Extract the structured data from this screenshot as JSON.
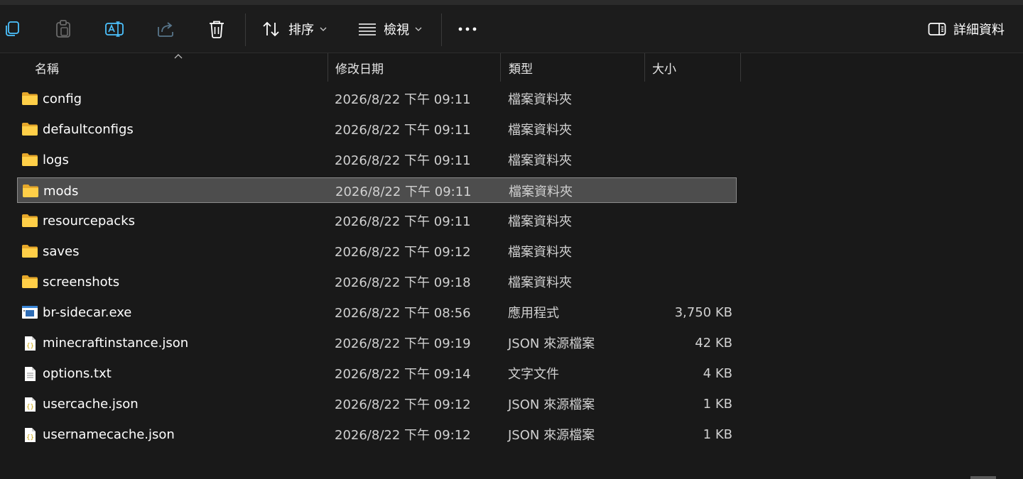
{
  "toolbar": {
    "sort_label": "排序",
    "view_label": "檢視",
    "details_label": "詳細資料"
  },
  "columns": {
    "name": "名稱",
    "modified": "修改日期",
    "type": "類型",
    "size": "大小"
  },
  "selected_index": 3,
  "files": [
    {
      "name": "config",
      "date": "2026/8/22 下午 09:11",
      "type": "檔案資料夾",
      "size": "",
      "icon": "folder-icon"
    },
    {
      "name": "defaultconfigs",
      "date": "2026/8/22 下午 09:11",
      "type": "檔案資料夾",
      "size": "",
      "icon": "folder-icon"
    },
    {
      "name": "logs",
      "date": "2026/8/22 下午 09:11",
      "type": "檔案資料夾",
      "size": "",
      "icon": "folder-icon"
    },
    {
      "name": "mods",
      "date": "2026/8/22 下午 09:11",
      "type": "檔案資料夾",
      "size": "",
      "icon": "folder-icon"
    },
    {
      "name": "resourcepacks",
      "date": "2026/8/22 下午 09:11",
      "type": "檔案資料夾",
      "size": "",
      "icon": "folder-icon"
    },
    {
      "name": "saves",
      "date": "2026/8/22 下午 09:12",
      "type": "檔案資料夾",
      "size": "",
      "icon": "folder-icon"
    },
    {
      "name": "screenshots",
      "date": "2026/8/22 下午 09:18",
      "type": "檔案資料夾",
      "size": "",
      "icon": "folder-icon"
    },
    {
      "name": "br-sidecar.exe",
      "date": "2026/8/22 下午 08:56",
      "type": "應用程式",
      "size": "3,750 KB",
      "icon": "exe-icon"
    },
    {
      "name": "minecraftinstance.json",
      "date": "2026/8/22 下午 09:19",
      "type": "JSON 來源檔案",
      "size": "42 KB",
      "icon": "json-file-icon"
    },
    {
      "name": "options.txt",
      "date": "2026/8/22 下午 09:14",
      "type": "文字文件",
      "size": "4 KB",
      "icon": "text-file-icon"
    },
    {
      "name": "usercache.json",
      "date": "2026/8/22 下午 09:12",
      "type": "JSON 來源檔案",
      "size": "1 KB",
      "icon": "json-file-icon"
    },
    {
      "name": "usernamecache.json",
      "date": "2026/8/22 下午 09:12",
      "type": "JSON 來源檔案",
      "size": "1 KB",
      "icon": "json-file-icon"
    }
  ]
}
